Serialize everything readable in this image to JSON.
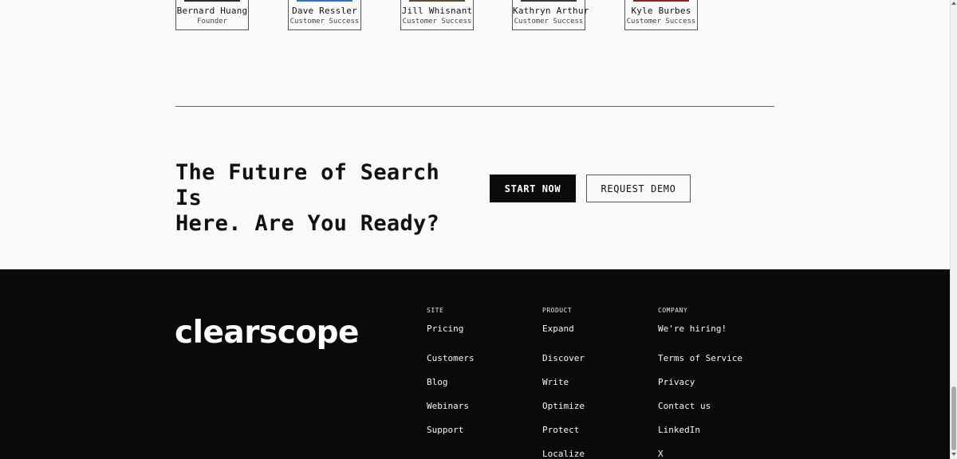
{
  "team": [
    {
      "name": "Bernard Huang",
      "role": "Founder"
    },
    {
      "name": "Dave Ressler",
      "role": "Customer Success"
    },
    {
      "name": "Jill Whisnant",
      "role": "Customer Success"
    },
    {
      "name": "Kathryn Arthur",
      "role": "Customer Success"
    },
    {
      "name": "Kyle Burbes",
      "role": "Customer Success"
    }
  ],
  "cta": {
    "headline_line1": "The Future of Search Is",
    "headline_line2": "Here. Are You Ready?",
    "primary_label": "START NOW",
    "secondary_label": "REQUEST DEMO"
  },
  "footer": {
    "logo_text": "clearscope",
    "columns": [
      {
        "heading": "SITE",
        "links": [
          "Pricing",
          "Customers",
          "Blog",
          "Webinars",
          "Support"
        ]
      },
      {
        "heading": "PRODUCT",
        "links": [
          "Expand",
          "Discover",
          "Write",
          "Optimize",
          "Protect",
          "Localize"
        ]
      },
      {
        "heading": "COMPANY",
        "links": [
          "We're hiring!",
          "Terms of Service",
          "Privacy",
          "Contact us",
          "LinkedIn",
          "X"
        ]
      }
    ]
  },
  "colors": {
    "page_bg": "#fafaf8",
    "footer_bg": "#0b0a09",
    "primary_button_bg": "#0b0b0b",
    "text_dark": "#111111",
    "text_light": "#f5f5f5"
  }
}
